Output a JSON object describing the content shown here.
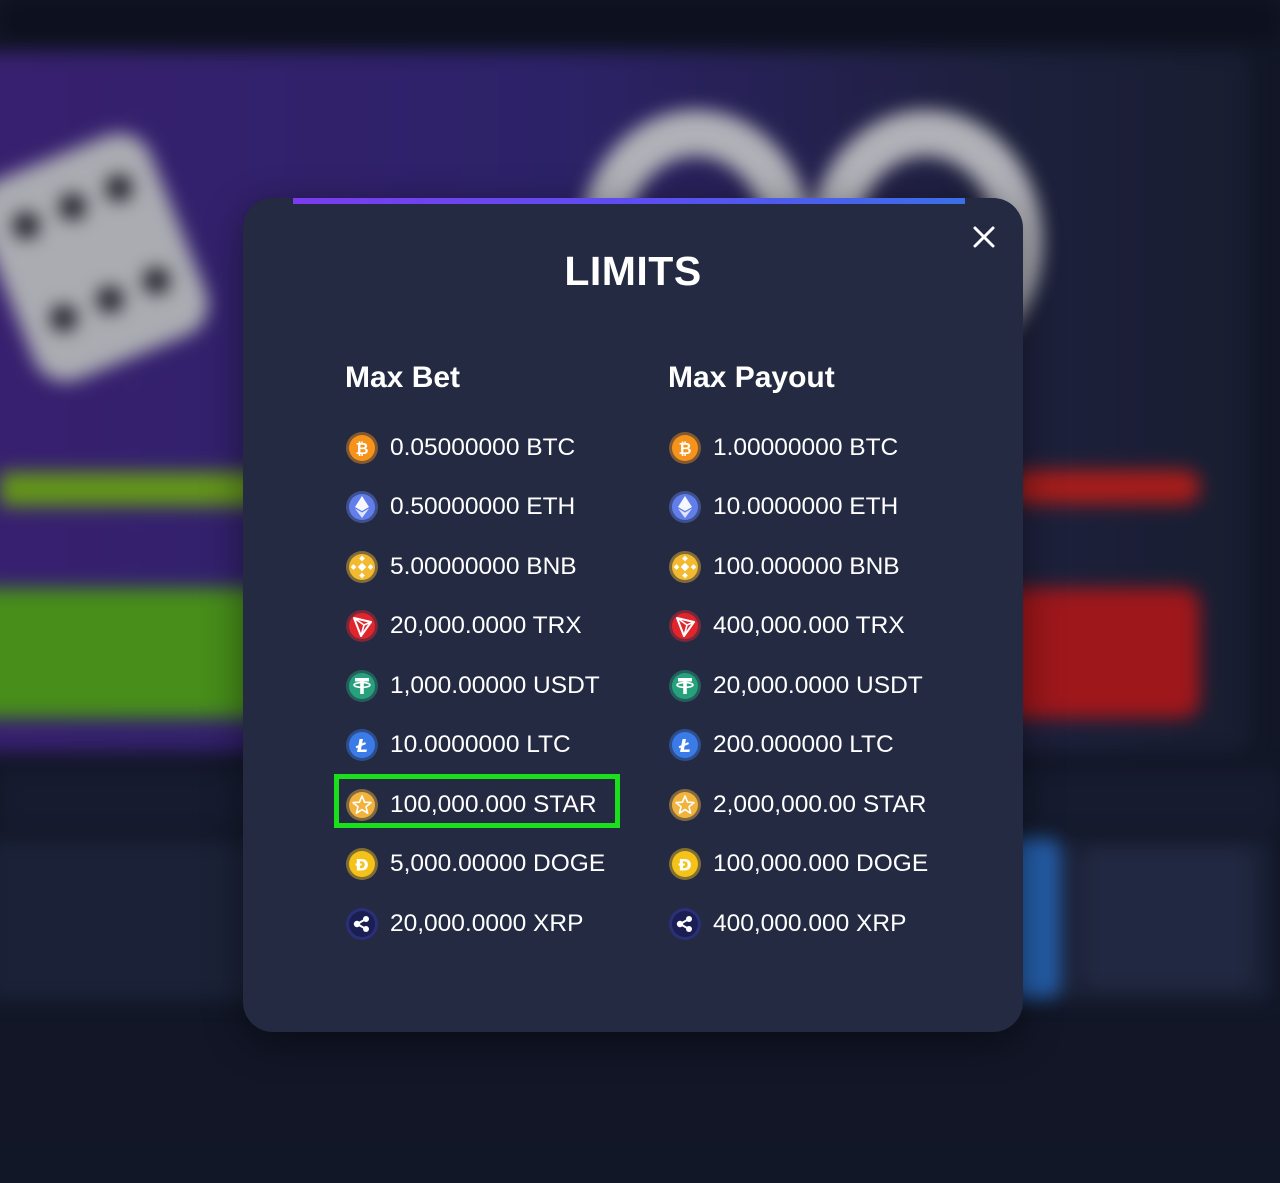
{
  "modal": {
    "title": "LIMITS",
    "close_icon": "close-icon",
    "accent_gradient": [
      "#7a3cf0",
      "#3b6fe8"
    ],
    "highlight_color": "#19e01a",
    "highlighted_row": "max_bet.6"
  },
  "max_bet": {
    "heading": "Max Bet",
    "rows": [
      {
        "coin": "BTC",
        "icon": "bitcoin-icon",
        "amount": "0.05000000 BTC"
      },
      {
        "coin": "ETH",
        "icon": "ethereum-icon",
        "amount": "0.50000000 ETH"
      },
      {
        "coin": "BNB",
        "icon": "bnb-icon",
        "amount": "5.00000000 BNB"
      },
      {
        "coin": "TRX",
        "icon": "tron-icon",
        "amount": "20,000.0000 TRX"
      },
      {
        "coin": "USDT",
        "icon": "tether-icon",
        "amount": "1,000.00000 USDT"
      },
      {
        "coin": "LTC",
        "icon": "litecoin-icon",
        "amount": "10.0000000 LTC"
      },
      {
        "coin": "STAR",
        "icon": "star-coin-icon",
        "amount": "100,000.000 STAR"
      },
      {
        "coin": "DOGE",
        "icon": "dogecoin-icon",
        "amount": "5,000.00000 DOGE"
      },
      {
        "coin": "XRP",
        "icon": "xrp-icon",
        "amount": "20,000.0000 XRP"
      }
    ]
  },
  "max_payout": {
    "heading": "Max Payout",
    "rows": [
      {
        "coin": "BTC",
        "icon": "bitcoin-icon",
        "amount": "1.00000000 BTC"
      },
      {
        "coin": "ETH",
        "icon": "ethereum-icon",
        "amount": "10.0000000 ETH"
      },
      {
        "coin": "BNB",
        "icon": "bnb-icon",
        "amount": "100.000000 BNB"
      },
      {
        "coin": "TRX",
        "icon": "tron-icon",
        "amount": "400,000.000 TRX"
      },
      {
        "coin": "USDT",
        "icon": "tether-icon",
        "amount": "20,000.0000 USDT"
      },
      {
        "coin": "LTC",
        "icon": "litecoin-icon",
        "amount": "200.000000 LTC"
      },
      {
        "coin": "STAR",
        "icon": "star-coin-icon",
        "amount": "2,000,000.00 STAR"
      },
      {
        "coin": "DOGE",
        "icon": "dogecoin-icon",
        "amount": "100,000.000 DOGE"
      },
      {
        "coin": "XRP",
        "icon": "xrp-icon",
        "amount": "400,000.000 XRP"
      }
    ]
  },
  "coin_colors": {
    "BTC": "#f7931a",
    "ETH": "#627eea",
    "BNB": "#f3ba2f",
    "TRX": "#e0252d",
    "USDT": "#26a17b",
    "LTC": "#3a7be8",
    "STAR": "#f2b33d",
    "DOGE": "#f5c21a",
    "XRP": "#2b2f78"
  }
}
